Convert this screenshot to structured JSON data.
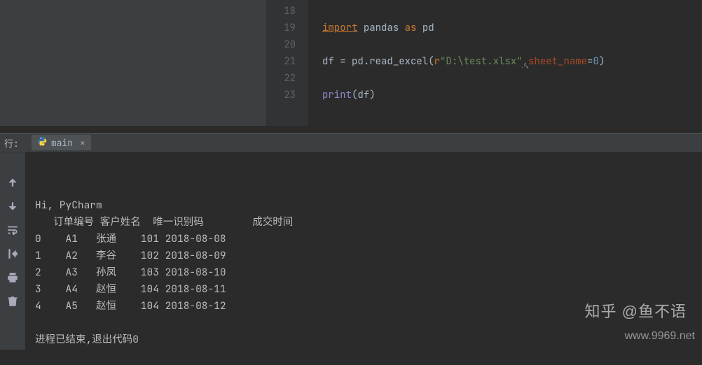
{
  "editor": {
    "line_numbers": [
      "18",
      "19",
      "20",
      "21",
      "22",
      "23"
    ],
    "code": {
      "l18": {
        "import": "import",
        "pandas": "pandas",
        "as": "as",
        "pd": "pd"
      },
      "l19": {
        "df": "df",
        "eq": " = ",
        "pd_read": "pd.read_excel(",
        "r": "r",
        "path": "\"D:\\test.xlsx\"",
        "comma_wave": ",",
        "param": "sheet_name",
        "eq2": "=",
        "zero": "0",
        "close": ")"
      },
      "l20": {
        "print": "print",
        "open": "(",
        "df": "df",
        "close": ")"
      }
    }
  },
  "panel": {
    "label": "行:",
    "tab_name": "main",
    "tab_close": "×"
  },
  "toolbar_icons": [
    "up-arrow-icon",
    "down-arrow-icon",
    "wrap-icon",
    "scroll-end-icon",
    "print-icon",
    "trash-icon"
  ],
  "console": {
    "greeting": "Hi, PyCharm",
    "header": "   订单编号 客户姓名  唯一识别码        成交时间",
    "rows": [
      "0    A1   张通    101 2018-08-08",
      "1    A2   李谷    102 2018-08-09",
      "2    A3   孙凤    103 2018-08-10",
      "3    A4   赵恒    104 2018-08-11",
      "4    A5   赵恒    104 2018-08-12"
    ],
    "exit": "进程已结束,退出代码0"
  },
  "watermarks": {
    "zhihu": "知乎 @鱼不语",
    "site": "www.9969.net"
  }
}
